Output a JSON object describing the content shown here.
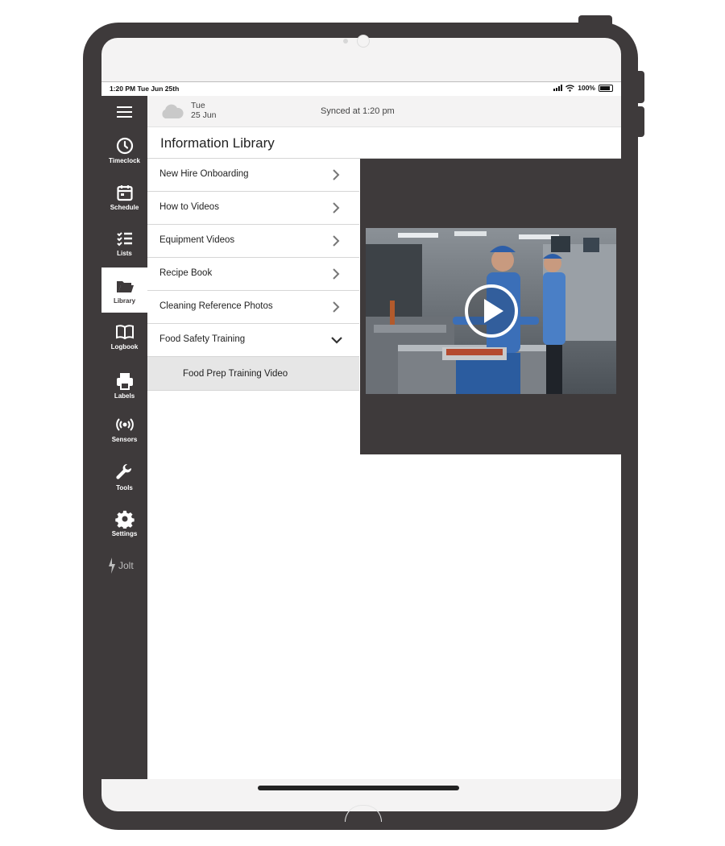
{
  "status_bar": {
    "time": "1:20 PM Tue Jun 25th",
    "battery": "100%"
  },
  "weather": {
    "day": "Tue",
    "date": "25 Jun",
    "icon": "cloud-icon"
  },
  "sync": {
    "text": "Synced at 1:20 pm"
  },
  "page": {
    "title": "Information Library"
  },
  "sidebar": {
    "items": [
      {
        "label": "Timeclock",
        "icon": "clock-icon"
      },
      {
        "label": "Schedule",
        "icon": "calendar-icon"
      },
      {
        "label": "Lists",
        "icon": "checklist-icon"
      },
      {
        "label": "Library",
        "icon": "folder-icon",
        "active": true
      },
      {
        "label": "Logbook",
        "icon": "book-icon"
      },
      {
        "label": "Labels",
        "icon": "printer-icon"
      },
      {
        "label": "Sensors",
        "icon": "sensor-icon"
      },
      {
        "label": "Tools",
        "icon": "wrench-icon"
      },
      {
        "label": "Settings",
        "icon": "gear-icon"
      }
    ],
    "brand": "Jolt"
  },
  "library": {
    "items": [
      {
        "label": "New Hire Onboarding"
      },
      {
        "label": "How to Videos"
      },
      {
        "label": "Equipment Videos"
      },
      {
        "label": "Recipe Book"
      },
      {
        "label": "Cleaning Reference Photos"
      },
      {
        "label": "Food Safety Training",
        "expanded": true
      }
    ],
    "sub_items": [
      {
        "label": "Food Prep Training Video",
        "selected": true
      }
    ]
  },
  "video": {
    "play_icon": "play-icon"
  },
  "colors": {
    "sidebar": "#3e3a3b",
    "accent_blue": "#2f5fa8"
  }
}
